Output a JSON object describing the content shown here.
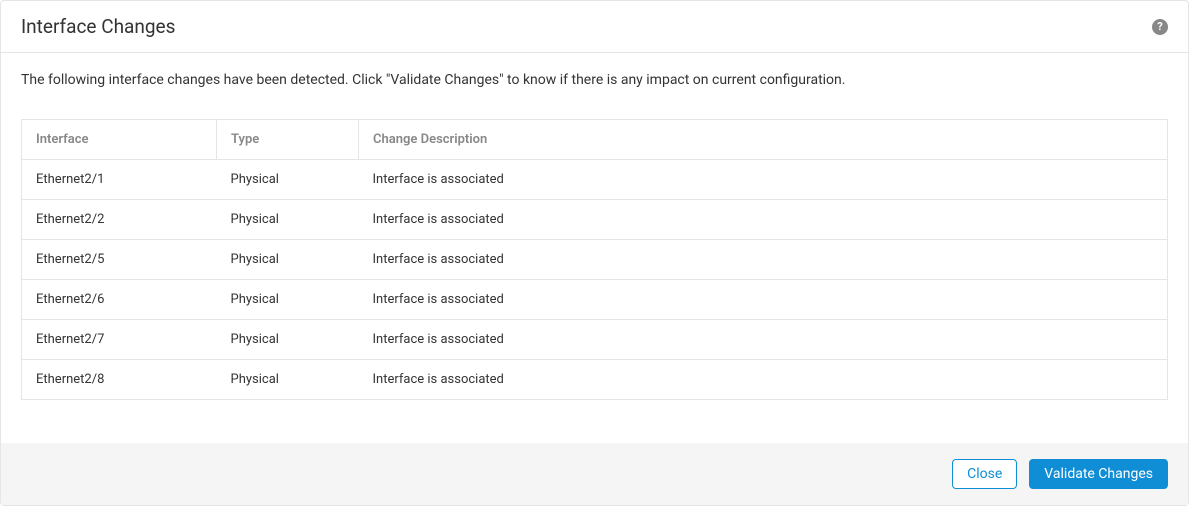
{
  "header": {
    "title": "Interface Changes"
  },
  "description": "The following interface changes have been detected. Click \"Validate Changes\" to know if there is any impact on current configuration.",
  "table": {
    "headers": {
      "interface": "Interface",
      "type": "Type",
      "change_description": "Change Description"
    },
    "rows": [
      {
        "interface": "Ethernet2/1",
        "type": "Physical",
        "change_description": "Interface is associated"
      },
      {
        "interface": "Ethernet2/2",
        "type": "Physical",
        "change_description": "Interface is associated"
      },
      {
        "interface": "Ethernet2/5",
        "type": "Physical",
        "change_description": "Interface is associated"
      },
      {
        "interface": "Ethernet2/6",
        "type": "Physical",
        "change_description": "Interface is associated"
      },
      {
        "interface": "Ethernet2/7",
        "type": "Physical",
        "change_description": "Interface is associated"
      },
      {
        "interface": "Ethernet2/8",
        "type": "Physical",
        "change_description": "Interface is associated"
      }
    ]
  },
  "footer": {
    "close_label": "Close",
    "validate_label": "Validate Changes"
  }
}
